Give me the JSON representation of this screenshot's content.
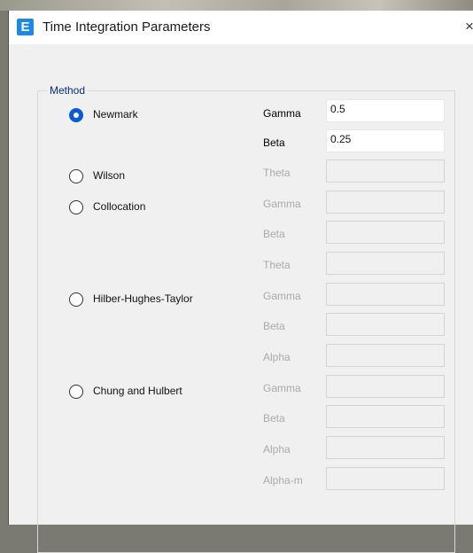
{
  "window": {
    "title": "Time Integration Parameters",
    "icon_letter": "E",
    "close_glyph": "×"
  },
  "group": {
    "title": "Method"
  },
  "methods": [
    {
      "label": "Newmark",
      "selected": true
    },
    {
      "label": "Wilson",
      "selected": false
    },
    {
      "label": "Collocation",
      "selected": false
    },
    {
      "label": "Hilber-Hughes-Taylor",
      "selected": false
    },
    {
      "label": "Chung and Hulbert",
      "selected": false
    }
  ],
  "params": [
    {
      "label": "Gamma",
      "value": "0.5",
      "enabled": true
    },
    {
      "label": "Beta",
      "value": "0.25",
      "enabled": true
    },
    {
      "label": "Theta",
      "value": "",
      "enabled": false
    },
    {
      "label": "Gamma",
      "value": "",
      "enabled": false
    },
    {
      "label": "Beta",
      "value": "",
      "enabled": false
    },
    {
      "label": "Theta",
      "value": "",
      "enabled": false
    },
    {
      "label": "Gamma",
      "value": "",
      "enabled": false
    },
    {
      "label": "Beta",
      "value": "",
      "enabled": false
    },
    {
      "label": "Alpha",
      "value": "",
      "enabled": false
    },
    {
      "label": "Gamma",
      "value": "",
      "enabled": false
    },
    {
      "label": "Beta",
      "value": "",
      "enabled": false
    },
    {
      "label": "Alpha",
      "value": "",
      "enabled": false
    },
    {
      "label": "Alpha-m",
      "value": "",
      "enabled": false
    }
  ],
  "colors": {
    "accent": "#0a5bd6",
    "group_title": "#0b2b82",
    "app_icon": "#1e88e5"
  }
}
